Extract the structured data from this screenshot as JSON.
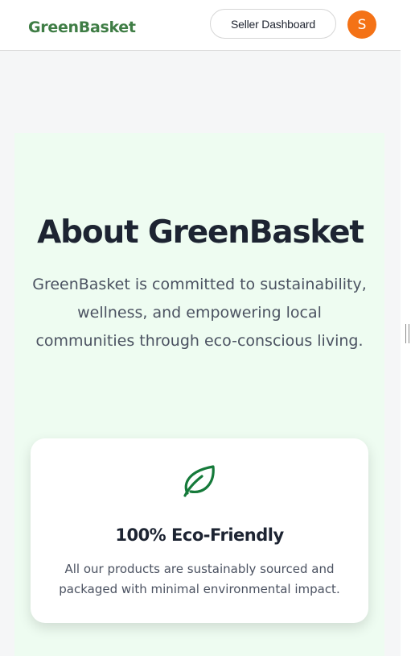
{
  "header": {
    "brand": "GreenBasket",
    "seller_dashboard_label": "Seller Dashboard",
    "avatar_initial": "S"
  },
  "about": {
    "title": "About GreenBasket",
    "description": "GreenBasket is committed to sustainability, wellness, and empowering local communities through eco-conscious living."
  },
  "feature_card": {
    "icon": "leaf-icon",
    "title": "100% Eco-Friendly",
    "description": "All our products are sustainably sourced and packaged with minimal environmental impact."
  },
  "colors": {
    "brand_green": "#3f7d45",
    "icon_green": "#157a3a",
    "avatar_orange": "#f47216",
    "hero_background": "#eefcf1",
    "page_background": "#f5f6f7"
  }
}
